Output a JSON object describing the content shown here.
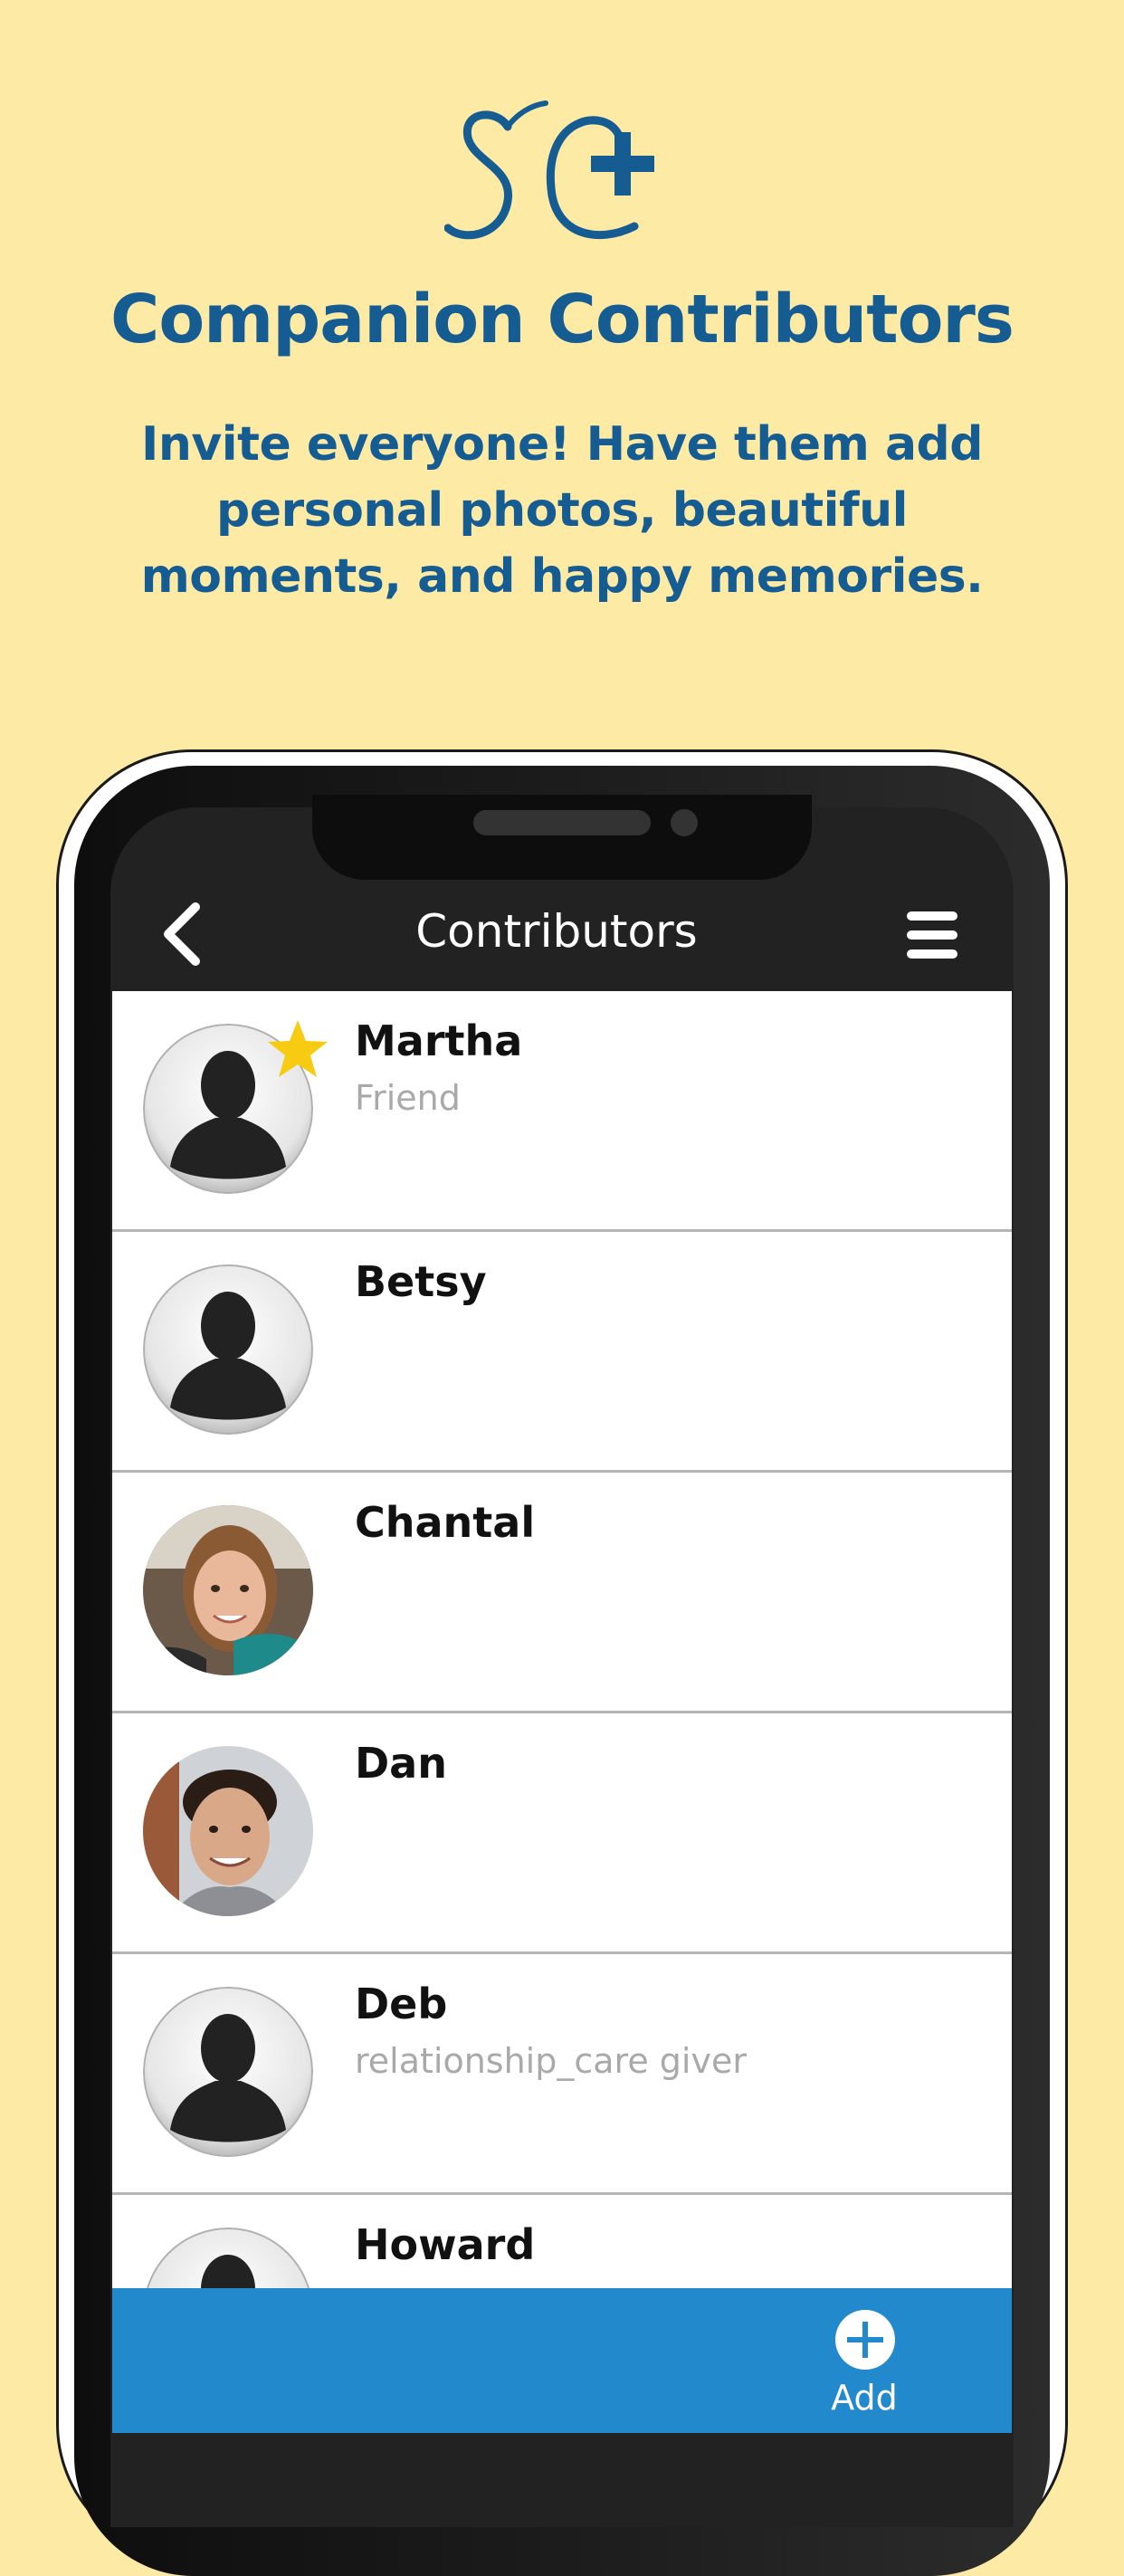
{
  "promo": {
    "logo_text": "SC",
    "title": "Companion Contributors",
    "subtitle": "Invite everyone! Have them add personal photos, beautiful moments, and happy memories."
  },
  "navbar": {
    "back_icon": "chevron-left-icon",
    "title": "Contributors",
    "menu_icon": "hamburger-menu-icon"
  },
  "contributors": [
    {
      "name": "Martha",
      "relationship": "Friend",
      "avatar": "default-silhouette",
      "starred": true
    },
    {
      "name": "Betsy",
      "relationship": "",
      "avatar": "default-silhouette",
      "starred": false
    },
    {
      "name": "Chantal",
      "relationship": "",
      "avatar": "photo",
      "starred": false
    },
    {
      "name": "Dan",
      "relationship": "",
      "avatar": "photo",
      "starred": false
    },
    {
      "name": "Deb",
      "relationship": "relationship_care giver",
      "avatar": "default-silhouette",
      "starred": false
    },
    {
      "name": "Howard",
      "relationship": "",
      "avatar": "default-silhouette",
      "starred": false
    }
  ],
  "bottom_bar": {
    "add_label": "Add",
    "add_icon": "plus-circle-icon"
  },
  "colors": {
    "background": "#FDEAA5",
    "brand_blue": "#155C93",
    "bar_blue": "#2189CC",
    "star_yellow": "#F6CB12"
  }
}
